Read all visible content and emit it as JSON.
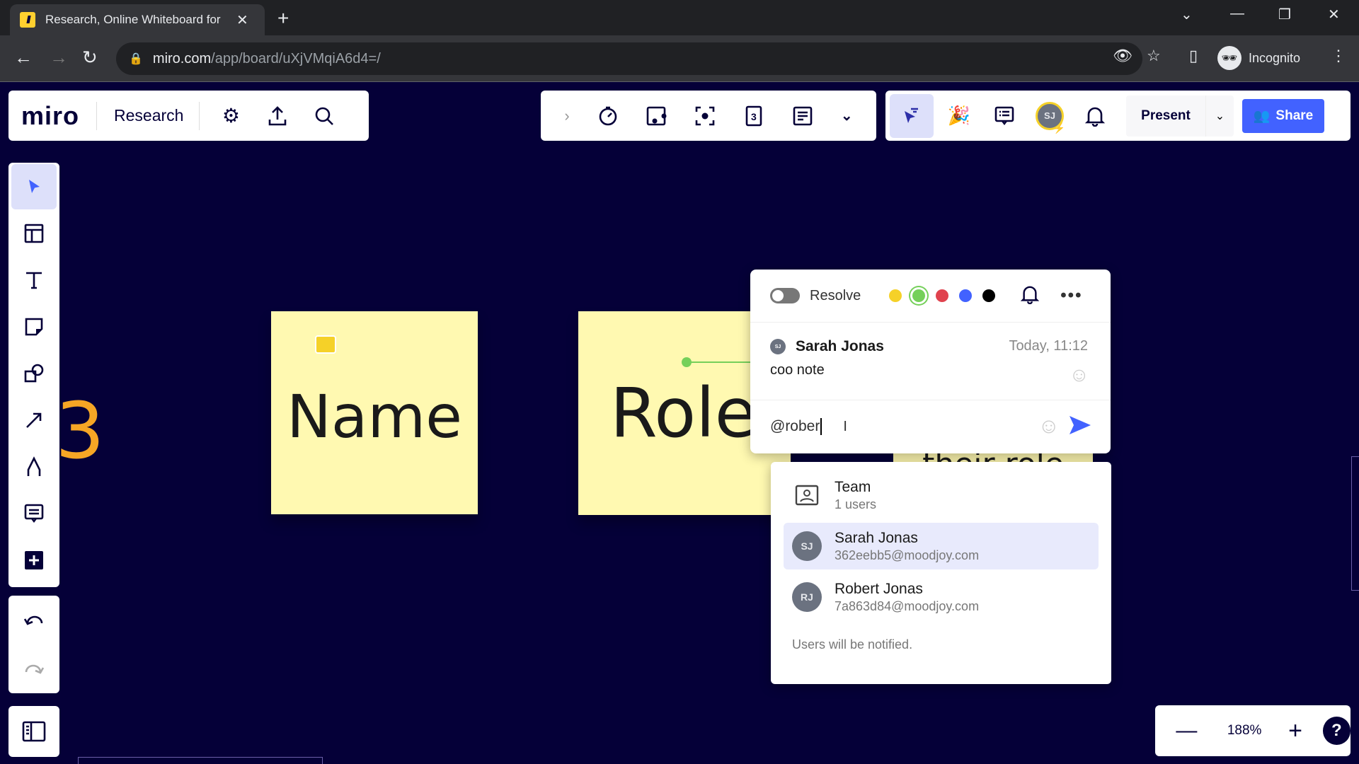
{
  "browser": {
    "tab_title": "Research, Online Whiteboard for",
    "url_host": "miro.com",
    "url_path": "/app/board/uXjVMqiA6d4=/",
    "profile_label": "Incognito"
  },
  "topbar": {
    "logo": "miro",
    "board_name": "Research",
    "present_label": "Present",
    "share_label": "Share",
    "avatar_initials": "SJ"
  },
  "canvas": {
    "sticky_notes": [
      {
        "text": "Name",
        "color": "#fff9b1"
      },
      {
        "text": "Role",
        "color": "#fff9b1"
      },
      {
        "text": "their role",
        "color": "#fff9b1"
      }
    ],
    "partial_number": "3"
  },
  "comment": {
    "resolve_label": "Resolve",
    "colors": [
      "#f5d128",
      "#75d05a",
      "#e0424e",
      "#4262ff",
      "#000000"
    ],
    "selected_color": "#75d05a",
    "author": "Sarah Jonas",
    "author_initials": "SJ",
    "time": "Today, 11:12",
    "text": "coo note",
    "reply_value": "@rober"
  },
  "mentions": {
    "items": [
      {
        "name": "Team",
        "sub": "1 users",
        "type": "team"
      },
      {
        "name": "Sarah Jonas",
        "sub": "362eebb5@moodjoy.com",
        "initials": "SJ",
        "highlighted": true
      },
      {
        "name": "Robert Jonas",
        "sub": "7a863d84@moodjoy.com",
        "initials": "RJ"
      }
    ],
    "footer": "Users will be notified."
  },
  "zoom": {
    "level": "188%"
  }
}
